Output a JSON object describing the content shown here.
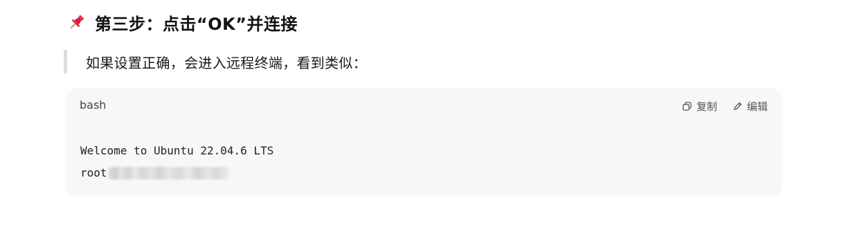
{
  "step": {
    "icon": "pushpin-icon",
    "title": "第三步：点击“OK”并连接"
  },
  "note": {
    "text": "如果设置正确，会进入远程终端，看到类似："
  },
  "code_block": {
    "language": "bash",
    "copy_label": "复制",
    "copy_icon": "copy-icon",
    "edit_label": "编辑",
    "edit_icon": "pencil-icon",
    "lines": [
      "Welcome to Ubuntu 22.04.6 LTS",
      "root"
    ]
  }
}
